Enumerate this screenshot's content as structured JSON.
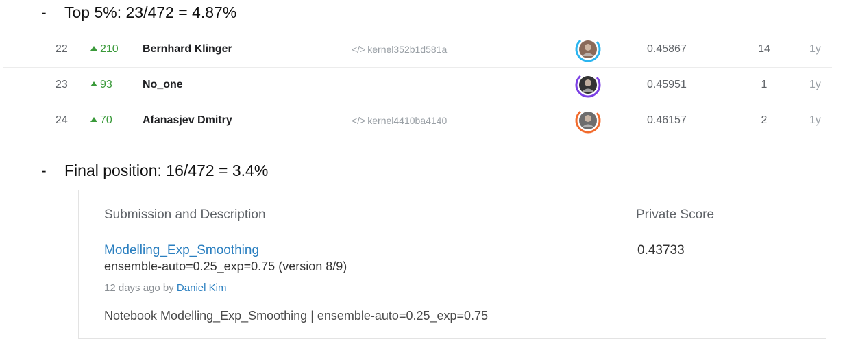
{
  "bullets": {
    "dash": "-",
    "top5": "Top 5%: 23/472 = 4.87%",
    "final": "Final position: 16/472 = 3.4%"
  },
  "leaderboard": {
    "rows": [
      {
        "rank": "22",
        "delta": "210",
        "team": "Bernhard Klinger",
        "kernel": "kernel352b1d581a",
        "score": "0.45867",
        "entries": "14",
        "last": "1y",
        "avatar_ring": "#2bb5f0",
        "avatar_ring_2": "#1e6fd9",
        "avatar_color": "#8a6a5a",
        "avatar_icon": "person-photo"
      },
      {
        "rank": "23",
        "delta": "93",
        "team": "No_one",
        "kernel": "",
        "score": "0.45951",
        "entries": "1",
        "last": "1y",
        "avatar_ring": "#7b3fe4",
        "avatar_ring_2": "#5a2bc2",
        "avatar_color": "#333333",
        "avatar_icon": "person-photo"
      },
      {
        "rank": "24",
        "delta": "70",
        "team": "Afanasjev Dmitry",
        "kernel": "kernel4410ba4140",
        "score": "0.46157",
        "entries": "2",
        "last": "1y",
        "avatar_ring": "#f26b2d",
        "avatar_ring_2": "#e0511a",
        "avatar_color": "#6d6d6d",
        "avatar_icon": "person-photo"
      }
    ],
    "delta_color": "#3a9a3a",
    "kernel_glyph": "</>"
  },
  "submission": {
    "header_left": "Submission and Description",
    "header_right": "Private Score",
    "title": "Modelling_Exp_Smoothing",
    "description": "ensemble-auto=0.25_exp=0.75 (version 8/9)",
    "meta_prefix": "12 days ago by ",
    "author": "Daniel Kim",
    "note": "Notebook Modelling_Exp_Smoothing | ensemble-auto=0.25_exp=0.75",
    "private_score": "0.43733",
    "link_color": "#2a7fc0"
  }
}
